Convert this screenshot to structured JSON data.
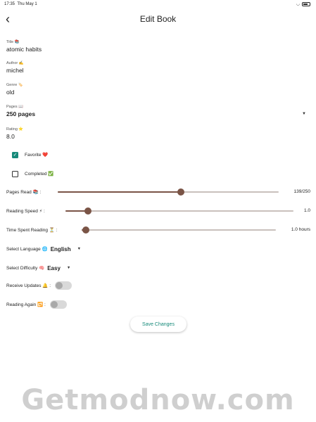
{
  "status_bar": {
    "time": "17:35",
    "date": "Thu May 1",
    "wifi_icon": "wifi-icon",
    "battery_icon": "battery-icon"
  },
  "app_bar": {
    "title": "Edit Book",
    "back_icon": "back-arrow-icon"
  },
  "form": {
    "title": {
      "label": "Title 📚",
      "value": "atomic habits"
    },
    "author": {
      "label": "Author ✍️",
      "value": "michel"
    },
    "genre": {
      "label": "Genre 🏷️",
      "value": "old"
    },
    "pages": {
      "label": "Pages 📖",
      "value": "250 pages"
    },
    "rating": {
      "label": "Rating ⭐",
      "value": "8.0"
    }
  },
  "checkboxes": {
    "favorite": {
      "label": "Favorite ❤️",
      "checked": true
    },
    "completed": {
      "label": "Completed ✅",
      "checked": false
    }
  },
  "sliders": {
    "pages_read": {
      "label": "Pages Read 📚 :",
      "value_text": "139/250",
      "fraction": 0.556
    },
    "reading_speed": {
      "label": "Reading Speed ⚡ :",
      "value_text": "1.0",
      "fraction": 0.1
    },
    "time_spent": {
      "label": "Time Spent Reading ⏳ :",
      "value_text": "1.0 hours",
      "fraction": 0.02
    }
  },
  "dropdowns": {
    "language": {
      "label": "Select Language 🌐",
      "value": "English"
    },
    "difficulty": {
      "label": "Select Difficulty 🧠",
      "value": "Easy"
    }
  },
  "toggles": {
    "receive_updates": {
      "label": "Receive Updates 🔔 :",
      "on": false
    },
    "reading_again": {
      "label": "Reading Again 🔁 :",
      "on": false
    }
  },
  "save_button": {
    "label": "Save Changes"
  },
  "colors": {
    "accent": "#168a7a",
    "slider": "#7a5446",
    "track": "#c9c0bc"
  },
  "watermark": "Getmodnow.com"
}
